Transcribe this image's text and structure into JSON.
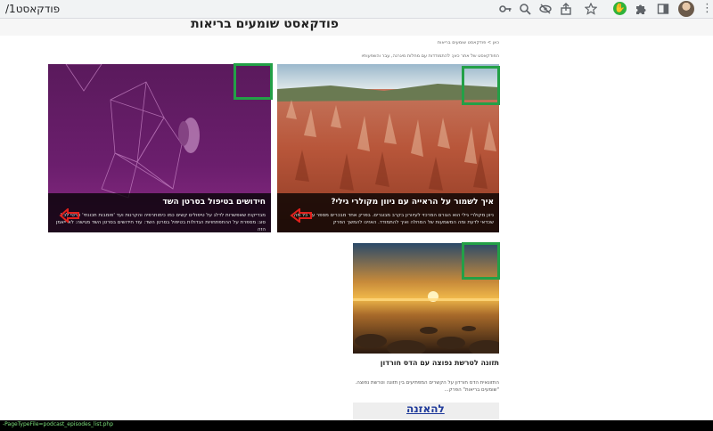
{
  "browser": {
    "url_text": "פודקאסט1/",
    "icons": [
      "key-icon",
      "zoom-icon",
      "eye-off-icon",
      "share-icon",
      "star-icon",
      "extension-green-icon",
      "puzzle-icon",
      "sidebar-icon",
      "profile-avatar",
      "kebab-menu-icon"
    ]
  },
  "header": {
    "page_title": "פודקאסט שומעים בריאות",
    "breadcrumb": "כאן > פודקאסט שומעים בריאות",
    "intro": "הפודקאסט של אתר כאן: להתמודדות עם מחלות מיגרנה, עבר והשפעותיו"
  },
  "cards": [
    {
      "title": "איך לשמור על הראייה עם ניוון מקולרי גילי?",
      "desc": "ניוון מקולרי גילי הוא הגורם המרכזי לעיוורון בקרב מבוגרים. בפרק אחד מבכרים מספר על כל מה שכדאי לדעת ומה המשמעות של המחלה ואיך להתמודד. האזינו להמשך הפרק"
    },
    {
      "title": "חידושים בטיפול בסרטן השד",
      "desc": "מבדיקות שאפשרות לדלג על טיפולים קשים כמו כימותרפיה והקרנות ועד 'פומבות תכונתי' פרטי לכל סוג: מספרת על ההתפתחויות הגדולות בטיפול בסרטן השד: עוד חידושים בסרטן השד מגישה: לא ייאמן הזה"
    }
  ],
  "podcast": {
    "title": "תזונה לטרשת נפוצה עם הדס חורדון",
    "desc": "התזונאית הדס חורדון על הקשרים המפתיעים בין תזונה וטרשת נפוצה. \"שומעים בריאות\" הפרק...",
    "listen_label": "להאזנה"
  },
  "status": {
    "text": "-PageTypeFile=podcast_episodes_list.php"
  }
}
